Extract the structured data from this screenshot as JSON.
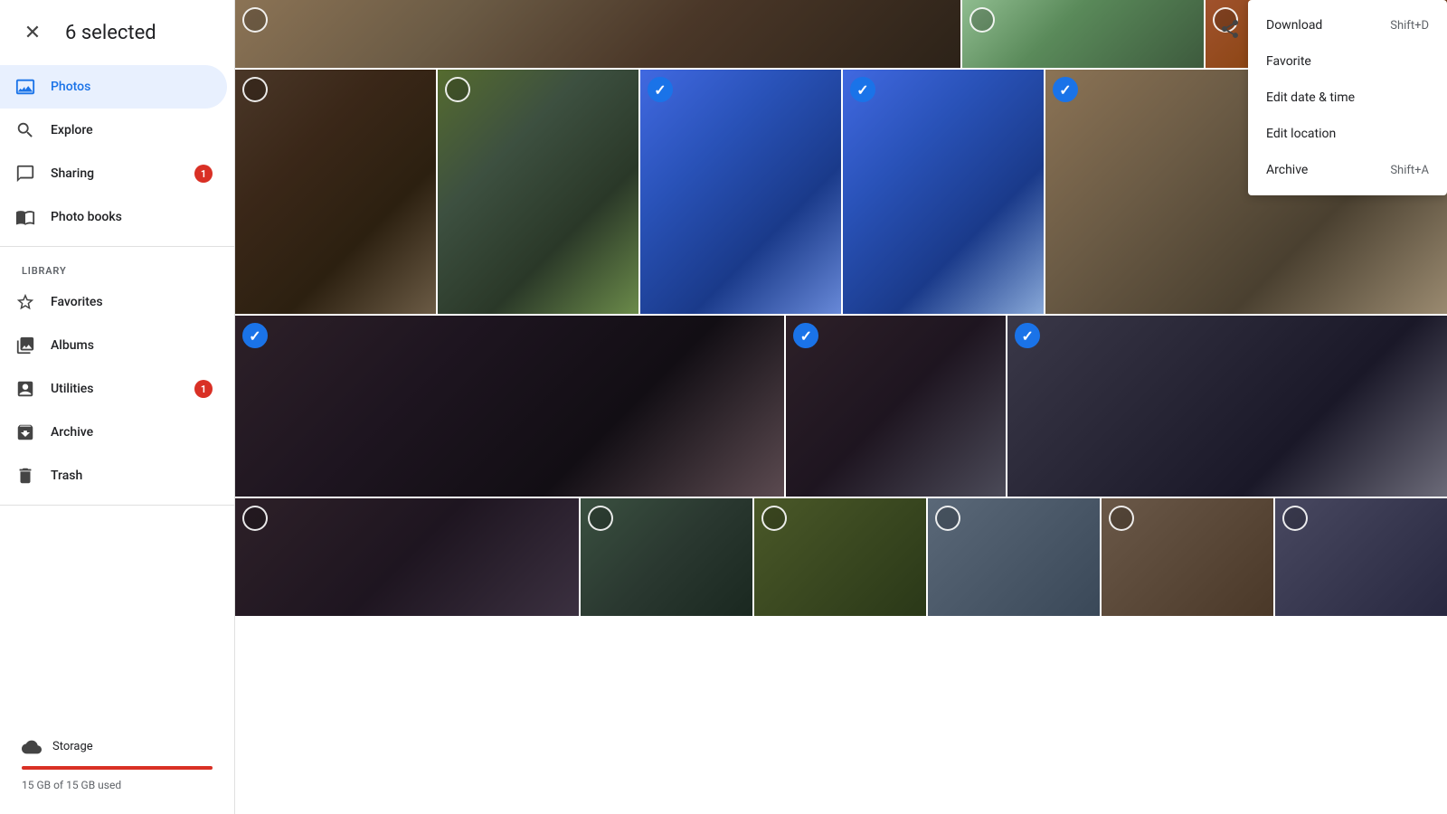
{
  "header": {
    "selected_count": "6 selected",
    "close_icon": "✕"
  },
  "sidebar": {
    "library_label": "LIBRARY",
    "items": [
      {
        "id": "photos",
        "label": "Photos",
        "icon": "🖼",
        "active": true,
        "badge": null
      },
      {
        "id": "explore",
        "label": "Explore",
        "icon": "🔍",
        "active": false,
        "badge": null
      },
      {
        "id": "sharing",
        "label": "Sharing",
        "icon": "💬",
        "active": false,
        "badge": "1"
      },
      {
        "id": "photo-books",
        "label": "Photo books",
        "icon": "📖",
        "active": false,
        "badge": null
      }
    ],
    "library_items": [
      {
        "id": "favorites",
        "label": "Favorites",
        "icon": "☆",
        "badge": null
      },
      {
        "id": "albums",
        "label": "Albums",
        "icon": "🖼",
        "badge": null
      },
      {
        "id": "utilities",
        "label": "Utilities",
        "icon": "📋",
        "badge": "1"
      },
      {
        "id": "archive",
        "label": "Archive",
        "icon": "⬇",
        "badge": null
      },
      {
        "id": "trash",
        "label": "Trash",
        "icon": "🗑",
        "badge": null
      }
    ],
    "storage": {
      "label": "Storage",
      "used_text": "15 GB of 15 GB used",
      "percent": 100
    }
  },
  "context_menu": {
    "items": [
      {
        "id": "download",
        "label": "Download",
        "shortcut": "Shift+D"
      },
      {
        "id": "favorite",
        "label": "Favorite",
        "shortcut": ""
      },
      {
        "id": "edit-date-time",
        "label": "Edit date & time",
        "shortcut": ""
      },
      {
        "id": "edit-location",
        "label": "Edit location",
        "shortcut": ""
      },
      {
        "id": "archive",
        "label": "Archive",
        "shortcut": "Shift+A"
      }
    ]
  },
  "photos": {
    "rows": [
      {
        "id": "row1",
        "cells": [
          {
            "id": "p1",
            "color": "p1",
            "selected": false,
            "wide": true
          },
          {
            "id": "p2",
            "color": "p2",
            "selected": false
          },
          {
            "id": "p3",
            "color": "p3",
            "selected": false
          }
        ]
      },
      {
        "id": "row2",
        "cells": [
          {
            "id": "p4",
            "color": "p4",
            "selected": false
          },
          {
            "id": "p5",
            "color": "p5",
            "selected": false
          },
          {
            "id": "p6",
            "color": "p6",
            "selected": true
          },
          {
            "id": "p7",
            "color": "p7",
            "selected": true
          },
          {
            "id": "p8",
            "color": "p8",
            "selected": true,
            "wide": true
          }
        ]
      },
      {
        "id": "row3",
        "cells": [
          {
            "id": "p9",
            "color": "p9",
            "selected": true,
            "wide": true
          },
          {
            "id": "p10",
            "color": "p10",
            "selected": false
          },
          {
            "id": "p11",
            "color": "p11",
            "selected": true
          },
          {
            "id": "p12",
            "color": "p12",
            "selected": true
          }
        ]
      },
      {
        "id": "row4",
        "cells": [
          {
            "id": "p13",
            "color": "p13",
            "selected": false,
            "wide": true
          },
          {
            "id": "p14",
            "color": "p14",
            "selected": false
          },
          {
            "id": "p15",
            "color": "p15",
            "selected": false
          },
          {
            "id": "p16",
            "color": "p16",
            "selected": false
          },
          {
            "id": "p17",
            "color": "p17",
            "selected": false
          },
          {
            "id": "p18",
            "color": "p18",
            "selected": false
          }
        ]
      }
    ]
  }
}
